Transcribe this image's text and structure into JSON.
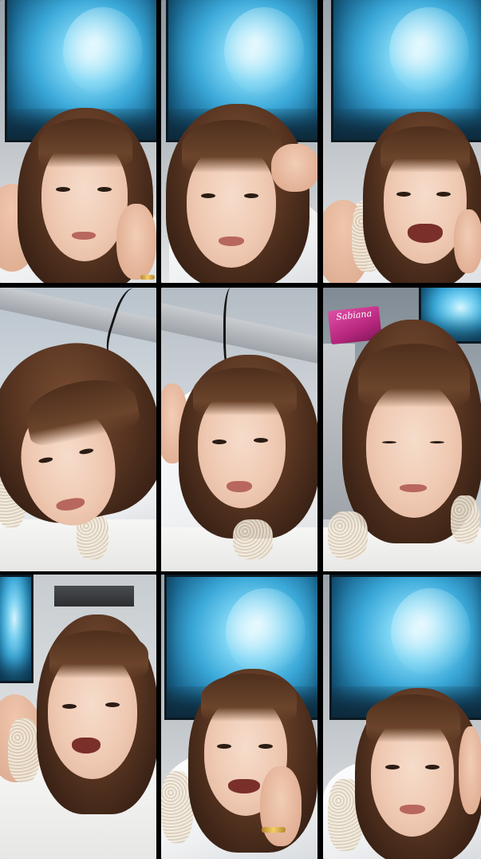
{
  "layout": {
    "type": "video-call-grid",
    "rows": 3,
    "columns": 3
  },
  "colors": {
    "background": "#000000",
    "poster_blue": "#3aa8d8",
    "hair": "#5a3622",
    "skin": "#efc9b2"
  },
  "tiles": [
    {
      "name": "participant-view-1",
      "scene": "lion-poster-bedroom"
    },
    {
      "name": "participant-view-2",
      "scene": "lion-poster-bedroom"
    },
    {
      "name": "participant-view-3",
      "scene": "lion-poster-bedroom"
    },
    {
      "name": "participant-view-4",
      "scene": "ceiling-shelf"
    },
    {
      "name": "participant-view-5",
      "scene": "ceiling-shelf"
    },
    {
      "name": "participant-view-6",
      "scene": "shelf-with-bag"
    },
    {
      "name": "participant-view-7",
      "scene": "room-corner"
    },
    {
      "name": "participant-view-8",
      "scene": "lion-poster-bedroom"
    },
    {
      "name": "participant-view-9",
      "scene": "lion-poster-bedroom"
    }
  ],
  "bag_text": "Sabiana"
}
